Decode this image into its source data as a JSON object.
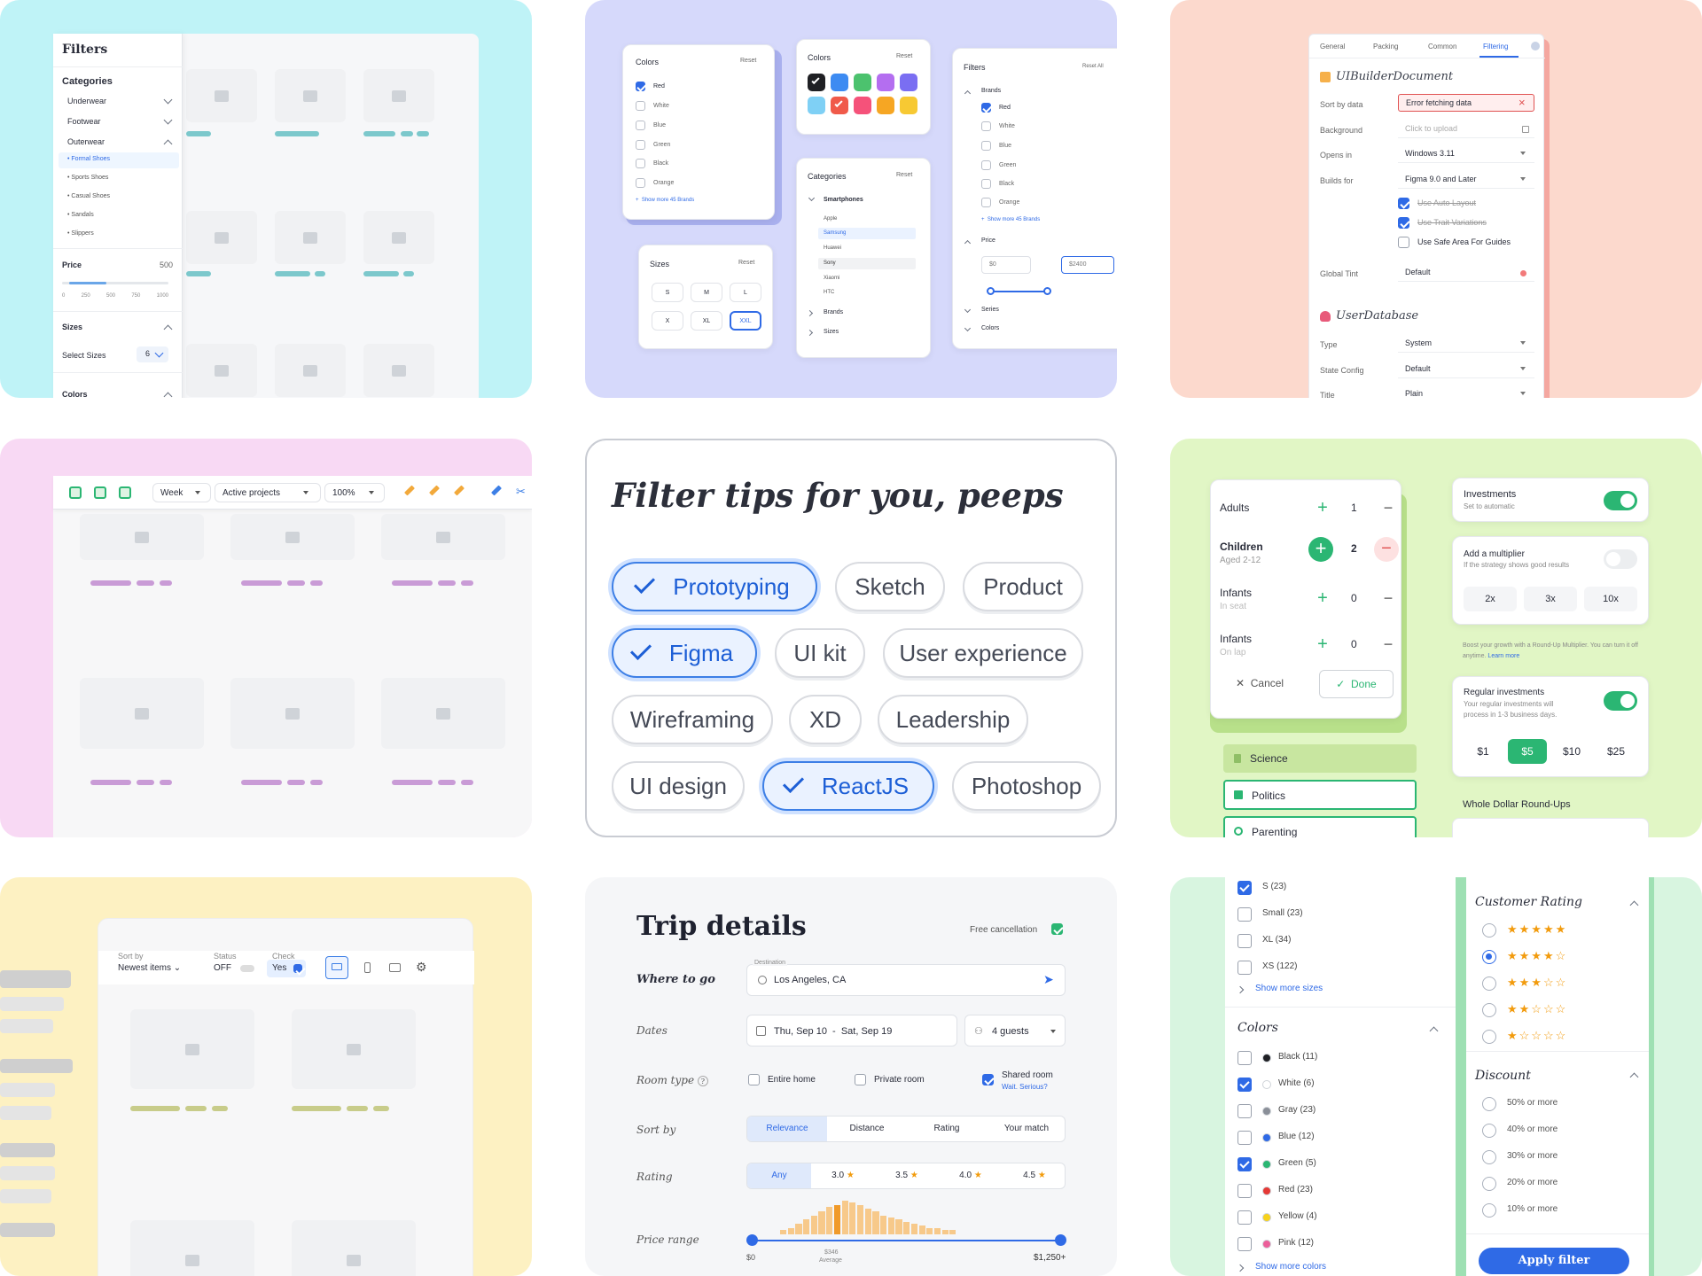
{
  "t1": {
    "title": "Filters",
    "categories": "Categories",
    "items": [
      "Underwear",
      "Footwear",
      "Outerwear"
    ],
    "sub": [
      "Formal Shoes",
      "Sports Shoes",
      "Casual Shoes",
      "Sandals",
      "Slippers"
    ],
    "price": "Price",
    "price_val": "500",
    "ticks": [
      "0",
      "250",
      "500",
      "750",
      "1000"
    ],
    "sizes": "Sizes",
    "select_sizes": "Select Sizes",
    "sizes_count": "6",
    "colors": "Colors"
  },
  "t2": {
    "colors_title": "Colors",
    "reset": "Reset",
    "color_list": [
      "Red",
      "White",
      "Blue",
      "Green",
      "Black",
      "Orange"
    ],
    "show_more": "Show more 45 Brands",
    "sizes_title": "Sizes",
    "sizes": [
      "S",
      "M",
      "L",
      "X",
      "XL",
      "XXL"
    ],
    "swatch_title": "Colors",
    "swatches": [
      "#1f2024",
      "#3d8bf2",
      "#4cc26e",
      "#b46ef0",
      "#7a6ef2",
      "#7fd0f5",
      "#f05a4a",
      "#f5527a",
      "#f6a623",
      "#f7c933"
    ],
    "cat_title": "Categories",
    "smartphones": "Smartphones",
    "brands": [
      "Apple",
      "Samsung",
      "Huawei",
      "Sony",
      "Xiaomi",
      "HTC"
    ],
    "brands_label": "Brands",
    "sizes_label": "Sizes",
    "filters_title": "Filters",
    "reset_all": "Reset All",
    "f_brands": "Brands",
    "f_colors": [
      "Red",
      "White",
      "Blue",
      "Green",
      "Black",
      "Orange"
    ],
    "f_show_more": "Show more 45 Brands",
    "f_price": "Price",
    "f_min": "$0",
    "f_max": "$2400",
    "f_series": "Series",
    "f_colors_label": "Colors"
  },
  "t3": {
    "tabs": [
      "General",
      "Packing",
      "Common",
      "Filtering"
    ],
    "doc_title": "UIBuilderDocument",
    "rows": [
      {
        "label": "Sort by data",
        "value": "Error fetching data"
      },
      {
        "label": "Background",
        "value": "Click to upload"
      },
      {
        "label": "Opens in",
        "value": "Windows 3.11"
      },
      {
        "label": "Builds for",
        "value": "Figma 9.0 and Later"
      }
    ],
    "checks": [
      "Use Auto Layout",
      "Use Trait Variations",
      "Use Safe Area For Guides"
    ],
    "tint_label": "Global Tint",
    "tint_value": "Default",
    "db_title": "UserDatabase",
    "db_rows": [
      {
        "label": "Type",
        "value": "System"
      },
      {
        "label": "State Config",
        "value": "Default"
      },
      {
        "label": "Title",
        "value": "Plain"
      }
    ]
  },
  "t4": {
    "week": "Week",
    "projects": "Active projects",
    "zoom": "100%"
  },
  "t5": {
    "title": "Filter tips for you, peeps",
    "pills": [
      "Prototyping",
      "Sketch",
      "Product",
      "Figma",
      "UI kit",
      "User experience",
      "Wireframing",
      "XD",
      "Leadership",
      "UI design",
      "ReactJS",
      "Photoshop"
    ]
  },
  "t6": {
    "rows": [
      {
        "label": "Adults",
        "sub": "",
        "value": "1"
      },
      {
        "label": "Children",
        "sub": "Aged 2-12",
        "value": "2"
      },
      {
        "label": "Infants",
        "sub": "In seat",
        "value": "0"
      },
      {
        "label": "Infants",
        "sub": "On lap",
        "value": "0"
      }
    ],
    "cancel": "Cancel",
    "done": "Done",
    "tags": [
      "Science",
      "Politics",
      "Parenting"
    ],
    "inv_title": "Investments",
    "inv_sub": "Set to automatic",
    "mult_title": "Add a multiplier",
    "mult_sub": "If the strategy shows good results",
    "mults": [
      "2x",
      "3x",
      "10x"
    ],
    "boost": "Boost your growth with a Round-Up Multiplier. You can turn it off anytime.",
    "learn": "Learn more",
    "reg_title": "Regular investments",
    "reg_sub": "Your regular investments will process in 1-3 business days.",
    "amounts": [
      "$1",
      "$5",
      "$10",
      "$25"
    ],
    "whole": "Whole Dollar Round-Ups"
  },
  "t7": {
    "sort_label": "Sort by",
    "sort_value": "Newest items",
    "status_label": "Status",
    "status_value": "OFF",
    "check_label": "Check",
    "check_value": "Yes"
  },
  "t8": {
    "title": "Trip details",
    "free": "Free cancellation",
    "where": "Where to go",
    "dest_label": "Destination",
    "dest": "Los Angeles, CA",
    "dates_label": "Dates",
    "dates": "Thu, Sep 10  -  Sat, Sep 19",
    "guests": "4 guests",
    "room_label": "Room type",
    "rooms": [
      "Entire home",
      "Private room",
      "Shared room"
    ],
    "wait": "Wait. Serious?",
    "sort_label": "Sort by",
    "sorts": [
      "Relevance",
      "Distance",
      "Rating",
      "Your match"
    ],
    "rating_label": "Rating",
    "ratings": [
      "Any",
      "3.0",
      "3.5",
      "4.0",
      "4.5"
    ],
    "price_label": "Price range",
    "pmin": "$0",
    "pavg": "$346",
    "pavg_label": "Average",
    "pmax": "$1,250+",
    "histogram": [
      2,
      3,
      5,
      7,
      9,
      11,
      13,
      14,
      16,
      15,
      14,
      12,
      11,
      9,
      8,
      7,
      6,
      5,
      4,
      3,
      3,
      2,
      2
    ]
  },
  "t9": {
    "sizes": [
      "S (23)",
      "Small (23)",
      "XL (34)",
      "XS (122)"
    ],
    "show_sizes": "Show more sizes",
    "colors_title": "Colors",
    "colors": [
      {
        "name": "Black (11)",
        "hex": "#1f2024",
        "on": false
      },
      {
        "name": "White (6)",
        "hex": "#ffffff",
        "on": true
      },
      {
        "name": "Gray (23)",
        "hex": "#8a8f98",
        "on": false
      },
      {
        "name": "Blue (12)",
        "hex": "#2f6ae6",
        "on": false
      },
      {
        "name": "Green (5)",
        "hex": "#2bb673",
        "on": true
      },
      {
        "name": "Red (23)",
        "hex": "#e53935",
        "on": false
      },
      {
        "name": "Yellow (4)",
        "hex": "#f7d21c",
        "on": false
      },
      {
        "name": "Pink (12)",
        "hex": "#ec5f9a",
        "on": false
      }
    ],
    "show_colors": "Show more colors",
    "rating_title": "Customer Rating",
    "ratings": [
      5,
      4,
      3,
      2,
      1
    ],
    "discount_title": "Discount",
    "discounts": [
      "50% or more",
      "40% or more",
      "30% or more",
      "20% or more",
      "10% or more"
    ],
    "apply": "Apply filter"
  }
}
